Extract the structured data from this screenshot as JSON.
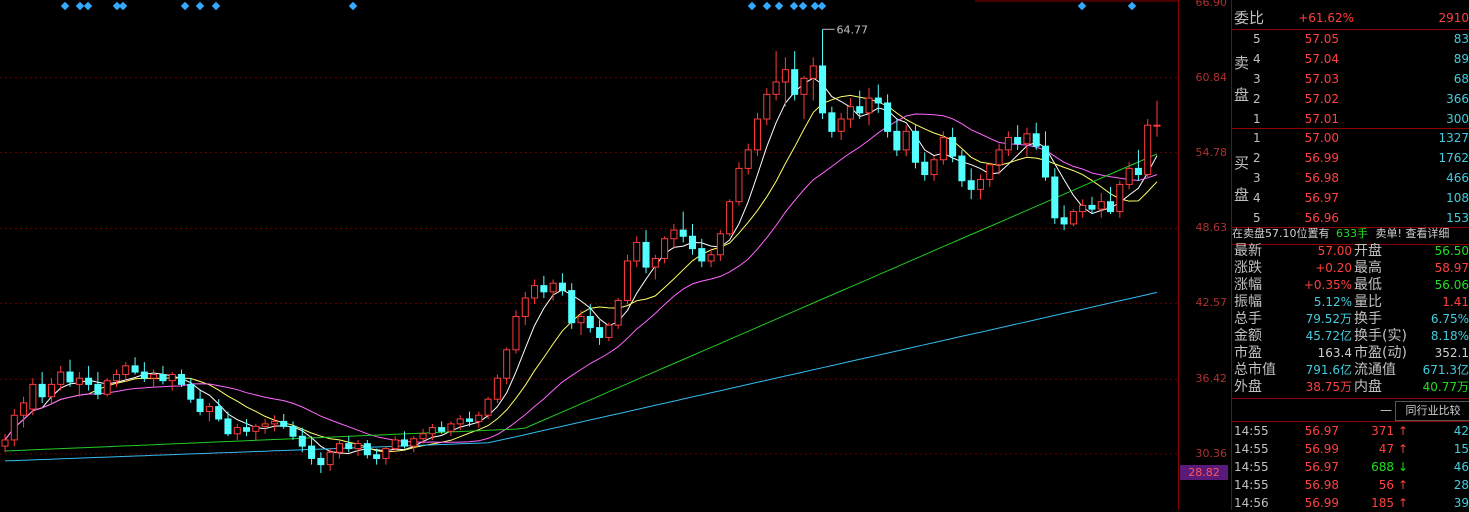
{
  "chart_data": {
    "type": "candlestick",
    "price_axis": [
      "66.90",
      "60.84",
      "54.78",
      "48.63",
      "42.57",
      "36.42",
      "30.36"
    ],
    "low_marker": "28.82",
    "high_annotation": "64.77",
    "candles": [
      [
        31,
        32,
        30.5,
        31.5
      ],
      [
        31.5,
        34,
        31,
        33.5
      ],
      [
        33.5,
        35,
        32.5,
        34.5
      ],
      [
        34,
        36.5,
        33.5,
        36
      ],
      [
        36,
        37,
        34.5,
        35
      ],
      [
        35,
        36.5,
        34.5,
        36
      ],
      [
        36,
        37.5,
        35.5,
        37
      ],
      [
        37,
        38,
        35.8,
        36.2
      ],
      [
        36,
        37,
        35,
        36.5
      ],
      [
        36.5,
        37.5,
        35.5,
        36
      ],
      [
        36,
        37,
        34.8,
        35.2
      ],
      [
        35.2,
        36.5,
        35,
        36.3
      ],
      [
        36.3,
        37.2,
        35.8,
        36.8
      ],
      [
        36.8,
        37.8,
        36.2,
        37.5
      ],
      [
        37.5,
        38.2,
        36.8,
        37
      ],
      [
        37,
        37.8,
        36.2,
        36.5
      ],
      [
        36.5,
        37.2,
        35.8,
        36.8
      ],
      [
        36.8,
        37.5,
        36,
        36.3
      ],
      [
        36.3,
        37,
        35.5,
        36.8
      ],
      [
        36.8,
        37.2,
        35.8,
        36
      ],
      [
        36,
        36.5,
        34.5,
        34.8
      ],
      [
        34.8,
        35.5,
        33.5,
        33.8
      ],
      [
        33.8,
        34.5,
        33,
        34.2
      ],
      [
        34.2,
        34.8,
        33,
        33.2
      ],
      [
        33.2,
        33.8,
        31.8,
        32
      ],
      [
        32,
        32.8,
        31.5,
        32.5
      ],
      [
        32.5,
        33.2,
        31.8,
        32.2
      ],
      [
        32.2,
        32.8,
        31.5,
        32.6
      ],
      [
        32.6,
        33.2,
        32,
        32.8
      ],
      [
        32.8,
        33.5,
        32.2,
        33
      ],
      [
        33,
        33.6,
        32.4,
        32.6
      ],
      [
        32.6,
        33,
        31.5,
        31.8
      ],
      [
        31.8,
        32.5,
        30.5,
        31
      ],
      [
        31,
        31.8,
        29.5,
        30
      ],
      [
        30,
        30.5,
        28.82,
        29.5
      ],
      [
        29.5,
        30.8,
        29,
        30.5
      ],
      [
        30.5,
        31.5,
        30,
        31.2
      ],
      [
        31.2,
        31.8,
        30.5,
        30.8
      ],
      [
        30.8,
        31.5,
        30.2,
        31.2
      ],
      [
        31.2,
        31.5,
        30,
        30.3
      ],
      [
        30.3,
        30.8,
        29.5,
        30
      ],
      [
        30,
        31,
        29.5,
        30.8
      ],
      [
        30.8,
        31.8,
        30.5,
        31.5
      ],
      [
        31.5,
        32.2,
        30.8,
        31
      ],
      [
        31,
        31.8,
        30.5,
        31.6
      ],
      [
        31.6,
        32.4,
        31.2,
        32
      ],
      [
        32,
        32.8,
        31.5,
        32.5
      ],
      [
        32.5,
        33,
        32,
        32.2
      ],
      [
        32.2,
        33,
        31.8,
        32.8
      ],
      [
        32.8,
        33.5,
        32.3,
        33.2
      ],
      [
        33.2,
        33.8,
        32.6,
        33
      ],
      [
        33,
        33.8,
        32.5,
        33.5
      ],
      [
        33.5,
        35,
        33.2,
        34.8
      ],
      [
        34.8,
        36.8,
        34.5,
        36.5
      ],
      [
        36.5,
        39,
        36,
        38.8
      ],
      [
        38.8,
        42,
        38.5,
        41.5
      ],
      [
        41.5,
        43.5,
        40.8,
        43
      ],
      [
        43,
        44.5,
        42.5,
        44
      ],
      [
        44,
        44.8,
        43,
        43.5
      ],
      [
        43.5,
        44.5,
        42.8,
        44.2
      ],
      [
        44.2,
        45,
        43.2,
        43.6
      ],
      [
        43.6,
        44.2,
        40.5,
        41
      ],
      [
        41,
        42,
        40,
        41.5
      ],
      [
        41.5,
        42.5,
        40.2,
        40.6
      ],
      [
        40.6,
        41.2,
        39.2,
        39.8
      ],
      [
        39.8,
        41,
        39.5,
        40.8
      ],
      [
        40.8,
        43,
        40.5,
        42.8
      ],
      [
        42.8,
        46.5,
        42.5,
        46
      ],
      [
        46,
        48,
        45.5,
        47.5
      ],
      [
        47.5,
        48.5,
        45,
        45.5
      ],
      [
        45.5,
        46.5,
        44.5,
        46.2
      ],
      [
        46.2,
        48,
        45.8,
        47.8
      ],
      [
        47.8,
        49,
        47,
        48.5
      ],
      [
        48.5,
        50,
        47.5,
        48
      ],
      [
        48,
        49,
        46.5,
        47
      ],
      [
        47,
        47.8,
        45.5,
        46
      ],
      [
        46,
        47,
        45.5,
        46.5
      ],
      [
        46.5,
        48.5,
        46,
        48.2
      ],
      [
        48.2,
        51,
        48,
        50.8
      ],
      [
        50.8,
        54,
        50.5,
        53.5
      ],
      [
        53.5,
        55.5,
        53,
        55
      ],
      [
        55,
        58,
        54.5,
        57.5
      ],
      [
        57.5,
        60,
        57,
        59.5
      ],
      [
        59.5,
        63,
        59,
        60.5
      ],
      [
        60.5,
        62.5,
        58.5,
        61.5
      ],
      [
        61.5,
        63,
        59,
        59.5
      ],
      [
        59.5,
        61,
        57.5,
        60.8
      ],
      [
        60.8,
        62.5,
        59,
        61.8
      ],
      [
        61.8,
        64.77,
        57.5,
        58
      ],
      [
        58,
        58.5,
        56,
        56.5
      ],
      [
        56.5,
        58,
        55.8,
        57.5
      ],
      [
        57.5,
        59.2,
        56.8,
        58.5
      ],
      [
        58.5,
        59.8,
        57.5,
        58
      ],
      [
        58,
        60,
        57,
        59.2
      ],
      [
        59.2,
        60.3,
        58,
        58.8
      ],
      [
        58.8,
        59.5,
        56,
        56.5
      ],
      [
        56.5,
        57.5,
        54.5,
        55
      ],
      [
        55,
        57,
        54.5,
        56.5
      ],
      [
        56.5,
        57,
        53.5,
        54
      ],
      [
        54,
        54.8,
        52.5,
        53
      ],
      [
        53,
        54.5,
        52.5,
        54.2
      ],
      [
        54.2,
        56.5,
        53.8,
        56
      ],
      [
        56,
        56.8,
        54,
        54.5
      ],
      [
        54.5,
        55,
        52,
        52.5
      ],
      [
        52.5,
        53.5,
        51,
        51.8
      ],
      [
        51.8,
        53,
        51,
        52.6
      ],
      [
        52.6,
        54,
        52,
        53.8
      ],
      [
        53.8,
        55.5,
        53,
        55
      ],
      [
        55,
        56.5,
        54.5,
        56
      ],
      [
        56,
        57,
        55,
        55.5
      ],
      [
        55.5,
        56.8,
        54.5,
        56.3
      ],
      [
        56.3,
        57.2,
        55,
        55.3
      ],
      [
        55.3,
        56.5,
        52.5,
        52.8
      ],
      [
        52.8,
        53.5,
        49,
        49.5
      ],
      [
        49.5,
        50.5,
        48.5,
        49
      ],
      [
        49,
        50.2,
        48.8,
        50
      ],
      [
        50,
        51,
        49.5,
        50.5
      ],
      [
        50.5,
        51.2,
        49.8,
        50.2
      ],
      [
        50.2,
        51.5,
        49.5,
        50.8
      ],
      [
        50.8,
        52,
        49.8,
        50
      ],
      [
        50,
        52.5,
        49.5,
        52.2
      ],
      [
        52.2,
        54,
        51.8,
        53.5
      ],
      [
        53.5,
        55,
        52.5,
        53
      ],
      [
        53,
        57.5,
        52.8,
        57
      ],
      [
        57,
        58.97,
        56.06,
        57
      ]
    ],
    "ma_lines": [
      {
        "color": "#ffffff",
        "period": 5
      },
      {
        "color": "#ffff66",
        "period": 10
      },
      {
        "color": "#ff66ff",
        "period": 20
      },
      {
        "color": "#22cc22",
        "period": 60
      },
      {
        "color": "#33bbee",
        "period": 120
      }
    ]
  },
  "markers": [
    65,
    80,
    88,
    117,
    123,
    185,
    200,
    216,
    353,
    752,
    767,
    779,
    794,
    803,
    815,
    822,
    1082,
    1132
  ],
  "panel": {
    "weibi": {
      "label": "委比",
      "pct": "+61.62%",
      "diff": "2910"
    },
    "sell_label_1": "卖",
    "sell_label_2": "盘",
    "buy_label_1": "买",
    "buy_label_2": "盘",
    "sells": [
      {
        "lvl": "5",
        "price": "57.05",
        "vol": "83"
      },
      {
        "lvl": "4",
        "price": "57.04",
        "vol": "89"
      },
      {
        "lvl": "3",
        "price": "57.03",
        "vol": "68"
      },
      {
        "lvl": "2",
        "price": "57.02",
        "vol": "366"
      },
      {
        "lvl": "1",
        "price": "57.01",
        "vol": "300"
      }
    ],
    "buys": [
      {
        "lvl": "1",
        "price": "57.00",
        "vol": "1327"
      },
      {
        "lvl": "2",
        "price": "56.99",
        "vol": "1762"
      },
      {
        "lvl": "3",
        "price": "56.98",
        "vol": "466"
      },
      {
        "lvl": "4",
        "price": "56.97",
        "vol": "108"
      },
      {
        "lvl": "5",
        "price": "56.96",
        "vol": "153"
      }
    ],
    "notice": {
      "prefix": "在卖盘57.10位置有",
      "qty": "633手",
      "suffix": "卖单! 查看详细"
    },
    "stats": [
      {
        "l1": "最新",
        "v1": "57.00",
        "c1": "red",
        "l2": "开盘",
        "v2": "56.50",
        "c2": "green"
      },
      {
        "l1": "涨跌",
        "v1": "+0.20",
        "c1": "red",
        "l2": "最高",
        "v2": "58.97",
        "c2": "red"
      },
      {
        "l1": "涨幅",
        "v1": "+0.35%",
        "c1": "red",
        "l2": "最低",
        "v2": "56.06",
        "c2": "green"
      },
      {
        "l1": "振幅",
        "v1": "5.12%",
        "c1": "cyan",
        "l2": "量比",
        "v2": "1.41",
        "c2": "red"
      },
      {
        "l1": "总手",
        "v1": "79.52万",
        "c1": "cyan",
        "l2": "换手",
        "v2": "6.75%",
        "c2": "cyan"
      },
      {
        "l1": "金额",
        "v1": "45.72亿",
        "c1": "cyan",
        "l2": "换手(实)",
        "v2": "8.18%",
        "c2": "cyan"
      },
      {
        "l1": "市盈",
        "v1": "163.4",
        "c1": "white",
        "l2": "市盈(动)",
        "v2": "352.1",
        "c2": "white"
      },
      {
        "l1": "总市值",
        "v1": "791.6亿",
        "c1": "cyan",
        "l2": "流通值",
        "v2": "671.3亿",
        "c2": "cyan"
      },
      {
        "l1": "外盘",
        "v1": "38.75万",
        "c1": "red",
        "l2": "内盘",
        "v2": "40.77万",
        "c2": "green"
      }
    ],
    "peer_button": "同行业比较",
    "dash": "—",
    "ticks": [
      {
        "time": "14:55",
        "price": "56.97",
        "vol": "371",
        "dir": "up",
        "num": "42"
      },
      {
        "time": "14:55",
        "price": "56.99",
        "vol": "47",
        "dir": "up",
        "num": "15"
      },
      {
        "time": "14:55",
        "price": "56.97",
        "vol": "688",
        "dir": "down",
        "num": "46"
      },
      {
        "time": "14:55",
        "price": "56.98",
        "vol": "56",
        "dir": "up",
        "num": "28"
      },
      {
        "time": "14:56",
        "price": "56.99",
        "vol": "185",
        "dir": "up",
        "num": "39"
      }
    ]
  }
}
